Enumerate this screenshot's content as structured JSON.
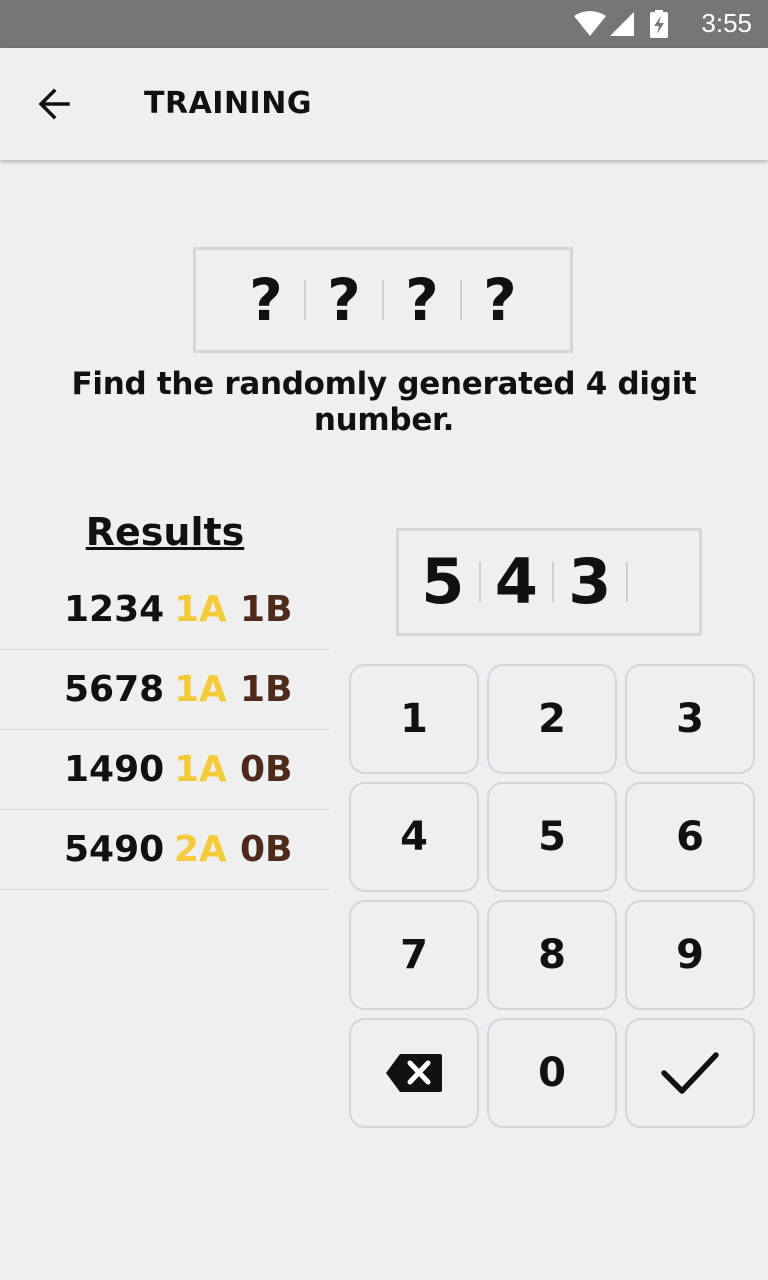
{
  "status_bar": {
    "time": "3:55",
    "icons": [
      "wifi-icon",
      "signal-icon",
      "battery-charging-icon"
    ]
  },
  "app_bar": {
    "title": "TRAINING",
    "back_icon": "arrow-left-icon"
  },
  "secret": {
    "slots": [
      "?",
      "?",
      "?",
      "?"
    ]
  },
  "instruction": "Find the randomly generated 4 digit number.",
  "results": {
    "title": "Results",
    "rows": [
      {
        "number": "1234",
        "a": "1A",
        "b": "1B"
      },
      {
        "number": "5678",
        "a": "1A",
        "b": "1B"
      },
      {
        "number": "1490",
        "a": "1A",
        "b": "0B"
      },
      {
        "number": "5490",
        "a": "2A",
        "b": "0B"
      }
    ]
  },
  "guess": {
    "digits": [
      "5",
      "4",
      "3",
      ""
    ]
  },
  "keypad": {
    "keys": [
      "1",
      "2",
      "3",
      "4",
      "5",
      "6",
      "7",
      "8",
      "9"
    ],
    "zero": "0",
    "delete_icon": "backspace-icon",
    "confirm_icon": "check-icon"
  },
  "colors": {
    "a_color": "#f5cb3c",
    "b_color": "#4e2a1a",
    "background": "#efefef",
    "status_bar": "#767676"
  }
}
